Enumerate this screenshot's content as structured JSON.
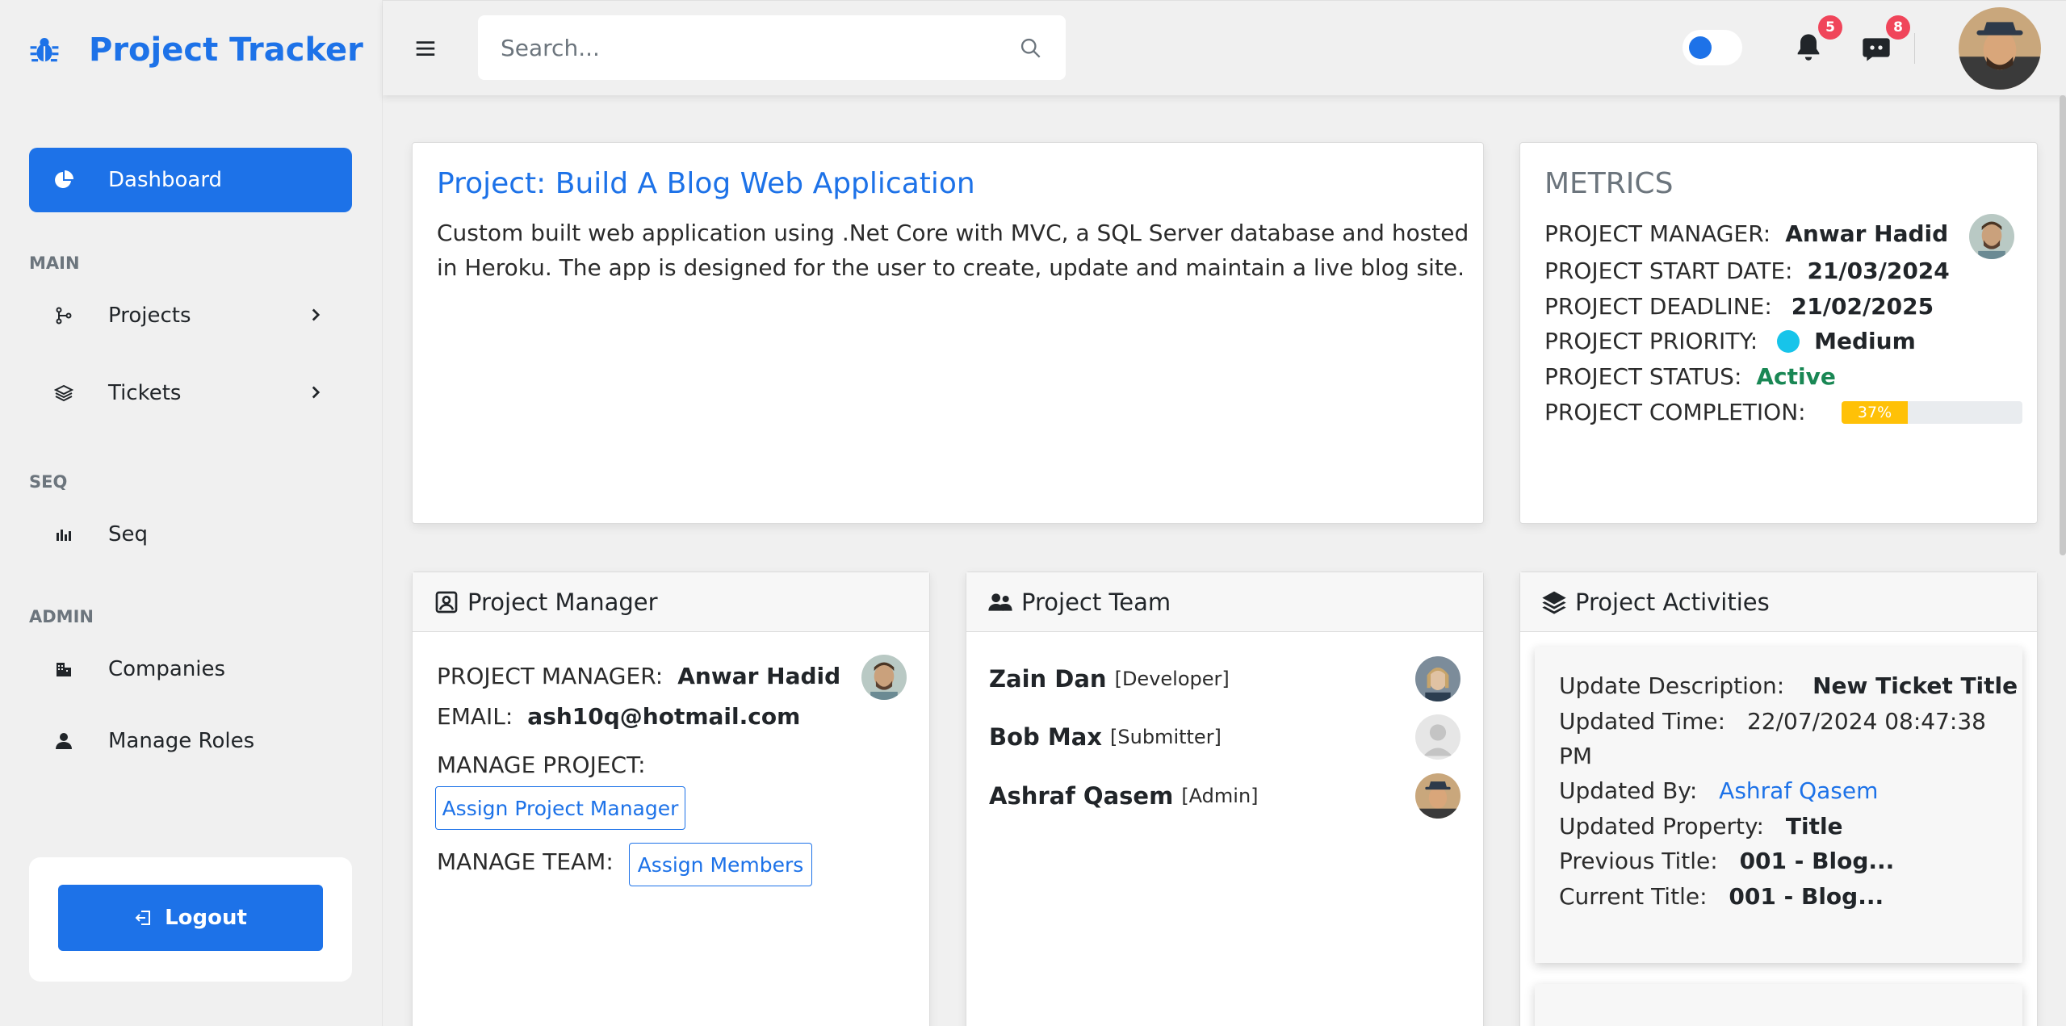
{
  "brand": {
    "title": "Project Tracker"
  },
  "sidebar": {
    "dashboard": "Dashboard",
    "sections": {
      "main": "MAIN",
      "seq": "SEQ",
      "admin": "ADMIN"
    },
    "items": {
      "projects": "Projects",
      "tickets": "Tickets",
      "seq": "Seq",
      "companies": "Companies",
      "roles": "Manage Roles"
    },
    "logout": "Logout"
  },
  "topbar": {
    "search_placeholder": "Search...",
    "notifications_count": "5",
    "messages_count": "8"
  },
  "project": {
    "title": "Project: Build A Blog Web Application",
    "description": "Custom built web application using .Net Core with MVC, a SQL Server database and hosted in Heroku. The app is designed for the user to create, update and maintain a live blog site."
  },
  "metrics": {
    "title": "METRICS",
    "manager_label": "PROJECT MANAGER:",
    "manager_value": "Anwar Hadid",
    "start_label": "PROJECT START DATE:",
    "start_value": "21/03/2024",
    "deadline_label": "PROJECT DEADLINE:",
    "deadline_value": "21/02/2025",
    "priority_label": "PROJECT PRIORITY:",
    "priority_value": "Medium",
    "status_label": "PROJECT STATUS:",
    "status_value": "Active",
    "completion_label": "PROJECT COMPLETION:",
    "completion_text": "37%",
    "completion_fraction": 0.37
  },
  "manager_card": {
    "title": "Project Manager",
    "manager_label": "PROJECT MANAGER:",
    "manager_value": "Anwar Hadid",
    "email_label": "EMAIL:",
    "email_value": "ash10q@hotmail.com",
    "manage_project_label": "MANAGE PROJECT:",
    "assign_manager_button": "Assign Project Manager",
    "manage_team_label": "MANAGE TEAM:",
    "assign_members_button": "Assign Members"
  },
  "team_card": {
    "title": "Project Team",
    "members": [
      {
        "name": "Zain Dan",
        "role": "[Developer]"
      },
      {
        "name": "Bob Max",
        "role": "[Submitter]"
      },
      {
        "name": "Ashraf Qasem",
        "role": "[Admin]"
      }
    ]
  },
  "activities_card": {
    "title": "Project Activities",
    "desc_label": "Update Description:",
    "desc_value": "New Ticket Title",
    "time_label": "Updated Time:",
    "time_value": "22/07/2024 08:47:38",
    "time_value_cont": "PM",
    "by_label": "Updated By:",
    "by_value": "Ashraf Qasem",
    "property_label": "Updated Property:",
    "property_value": "Title",
    "previous_label": "Previous Title:",
    "previous_value": "001 - Blog...",
    "current_label": "Current Title:",
    "current_value": "001 - Blog..."
  },
  "colors": {
    "accent": "#1d72e8",
    "badge": "#f0455a",
    "success": "#198754",
    "priority": "#17c4ea",
    "progress": "#ffc107"
  }
}
